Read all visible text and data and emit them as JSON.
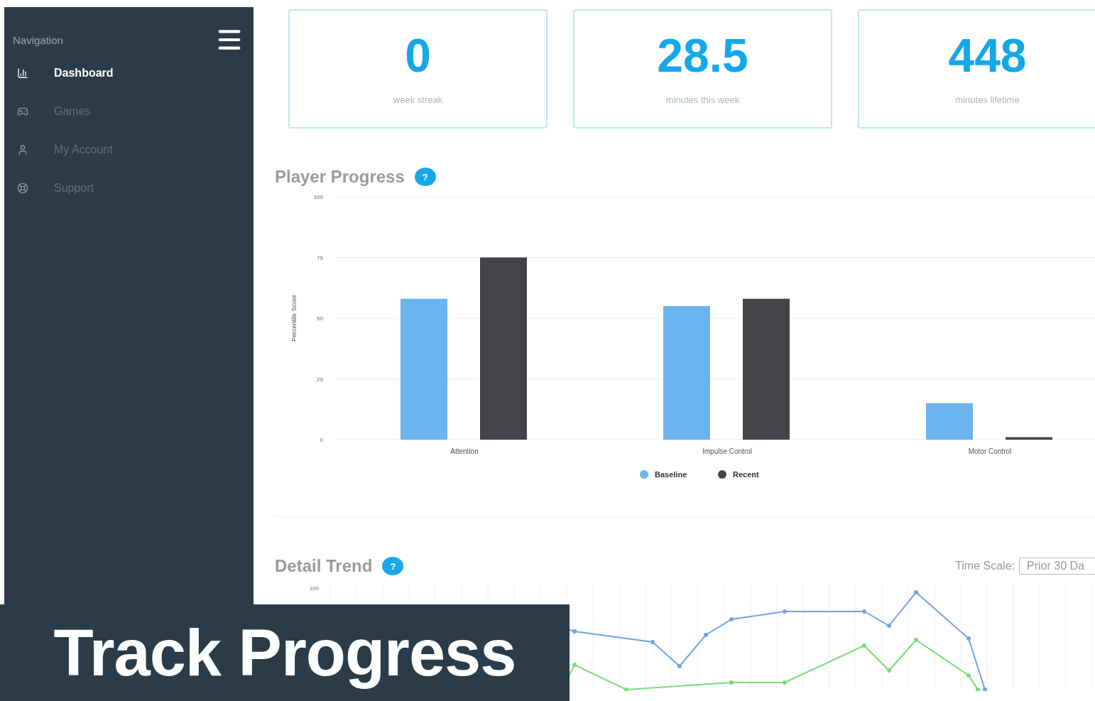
{
  "sidebar": {
    "title": "Navigation",
    "items": [
      {
        "label": "Dashboard",
        "kind": "chart",
        "selected": true
      },
      {
        "label": "Games",
        "kind": "game",
        "selected": false
      },
      {
        "label": "My Account",
        "kind": "user",
        "selected": false
      },
      {
        "label": "Support",
        "kind": "help",
        "selected": false
      }
    ]
  },
  "stats": [
    {
      "value": "0",
      "label": "week streak"
    },
    {
      "value": "28.5",
      "label": "minutes this week"
    },
    {
      "value": "448",
      "label": "minutes lifetime"
    }
  ],
  "player_progress": {
    "title": "Player Progress",
    "help": "?",
    "chart_data": {
      "type": "bar",
      "ylabel": "Percentile Score",
      "categories": [
        "Attention",
        "Impulse Control",
        "Motor Control"
      ],
      "ylim": [
        0,
        100
      ],
      "yticks": [
        0,
        25,
        50,
        75,
        100
      ],
      "grid": true,
      "legend": "bottom",
      "series": [
        {
          "name": "Baseline",
          "color": "#6cb4ee",
          "values": [
            58,
            55,
            15
          ]
        },
        {
          "name": "Recent",
          "color": "#434348",
          "values": [
            75,
            58,
            1
          ]
        }
      ]
    }
  },
  "detail_trend": {
    "title": "Detail Trend",
    "help": "?",
    "time_scale_label": "Time Scale:",
    "time_scale_value": "Prior 30 Da",
    "y_tick": "100"
  },
  "banner": {
    "title": "Track Progress"
  }
}
